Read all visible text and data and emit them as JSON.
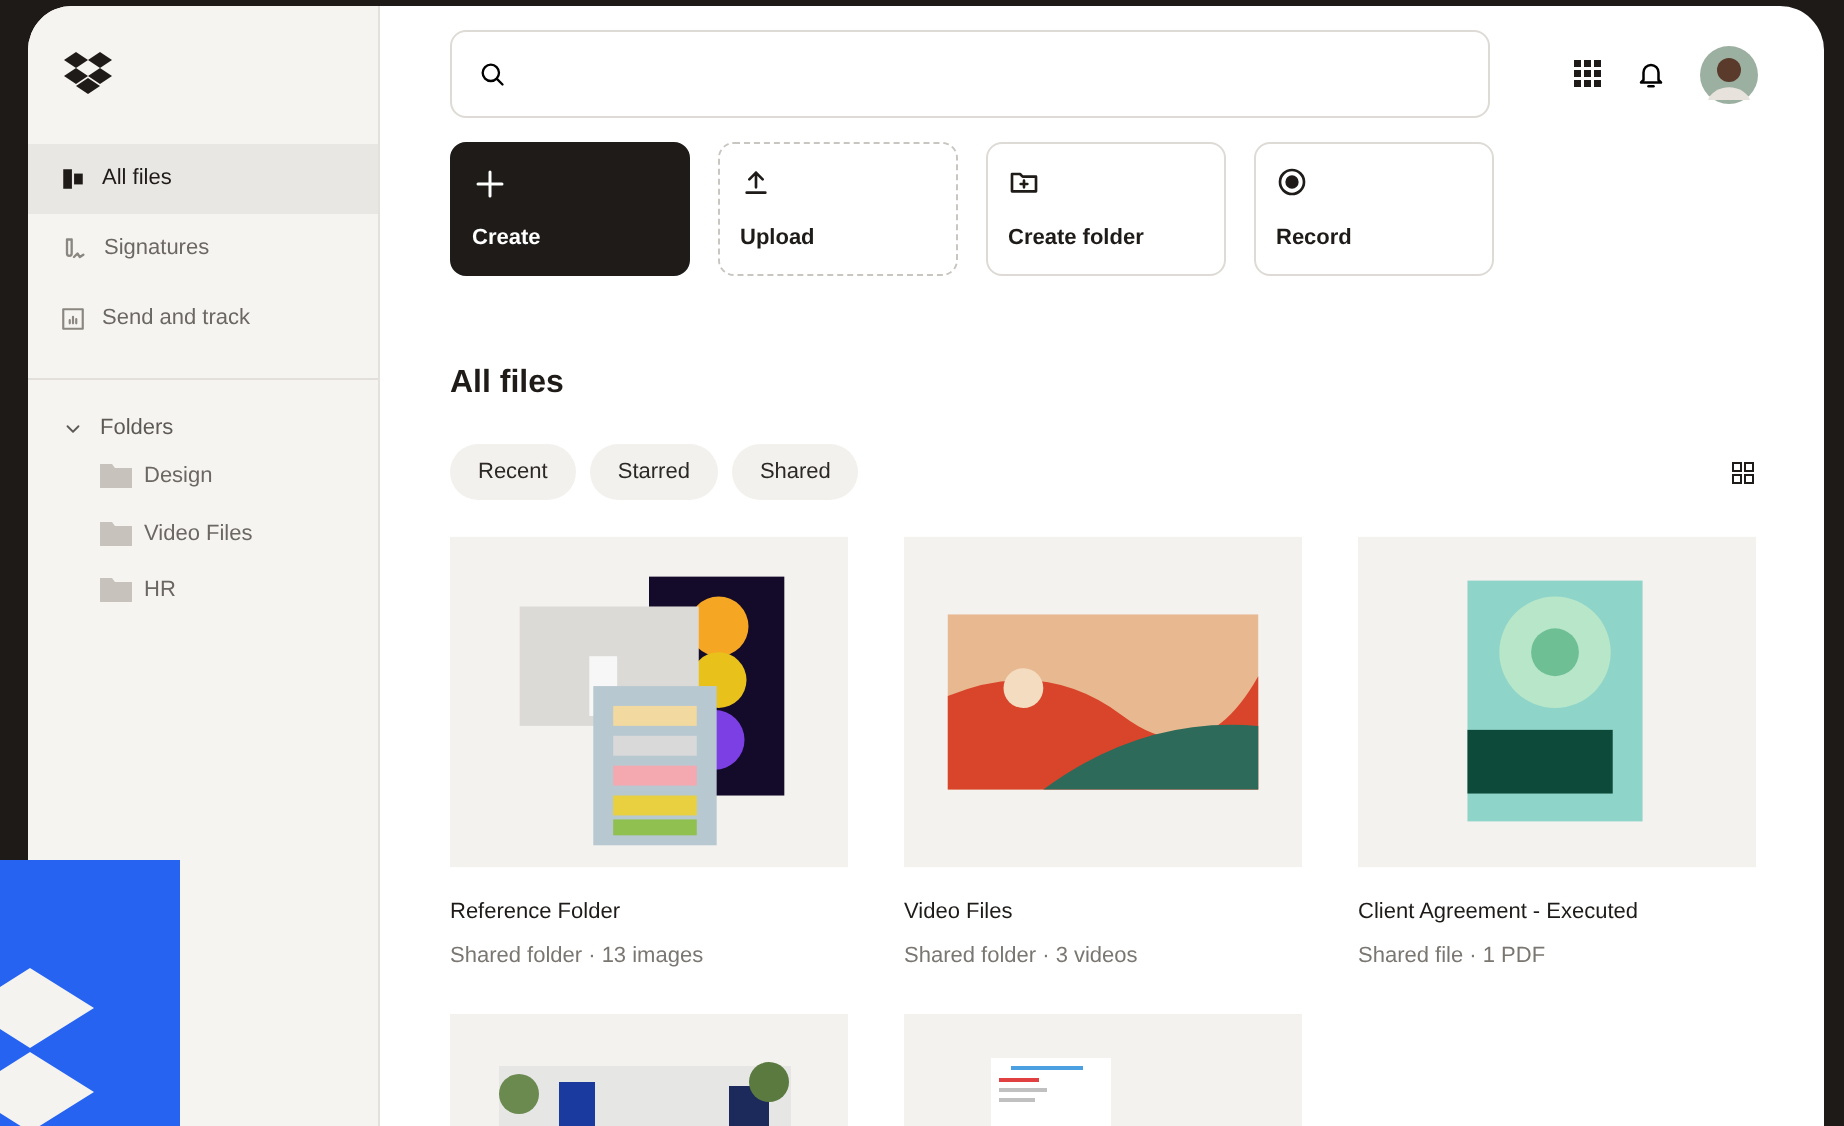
{
  "sidebar": {
    "items": [
      {
        "label": "All files",
        "selected": true
      },
      {
        "label": "Signatures",
        "selected": false
      },
      {
        "label": "Send and track",
        "selected": false
      }
    ],
    "folders": {
      "label": "Folders",
      "expanded": true,
      "children": [
        {
          "label": "Design"
        },
        {
          "label": "Video Files"
        },
        {
          "label": "HR"
        }
      ]
    }
  },
  "actions": [
    {
      "label": "Create",
      "kind": "primary"
    },
    {
      "label": "Upload",
      "kind": "dashed"
    },
    {
      "label": "Create folder",
      "kind": "outline"
    },
    {
      "label": "Record",
      "kind": "outline"
    }
  ],
  "heading": "All files",
  "filters": [
    {
      "label": "Recent",
      "selected": false
    },
    {
      "label": "Starred",
      "selected": false
    },
    {
      "label": "Shared",
      "selected": false
    }
  ],
  "files": [
    {
      "name": "Reference Folder",
      "detail": "Shared folder · 13 images",
      "kind": "collage"
    },
    {
      "name": "Video Files",
      "detail": "Shared folder · 3 videos",
      "kind": "wave"
    },
    {
      "name": "Client Agreement - Executed",
      "detail": "Shared file · 1 PDF",
      "kind": "cover"
    },
    {
      "kind": "building"
    },
    {
      "kind": "document"
    }
  ]
}
